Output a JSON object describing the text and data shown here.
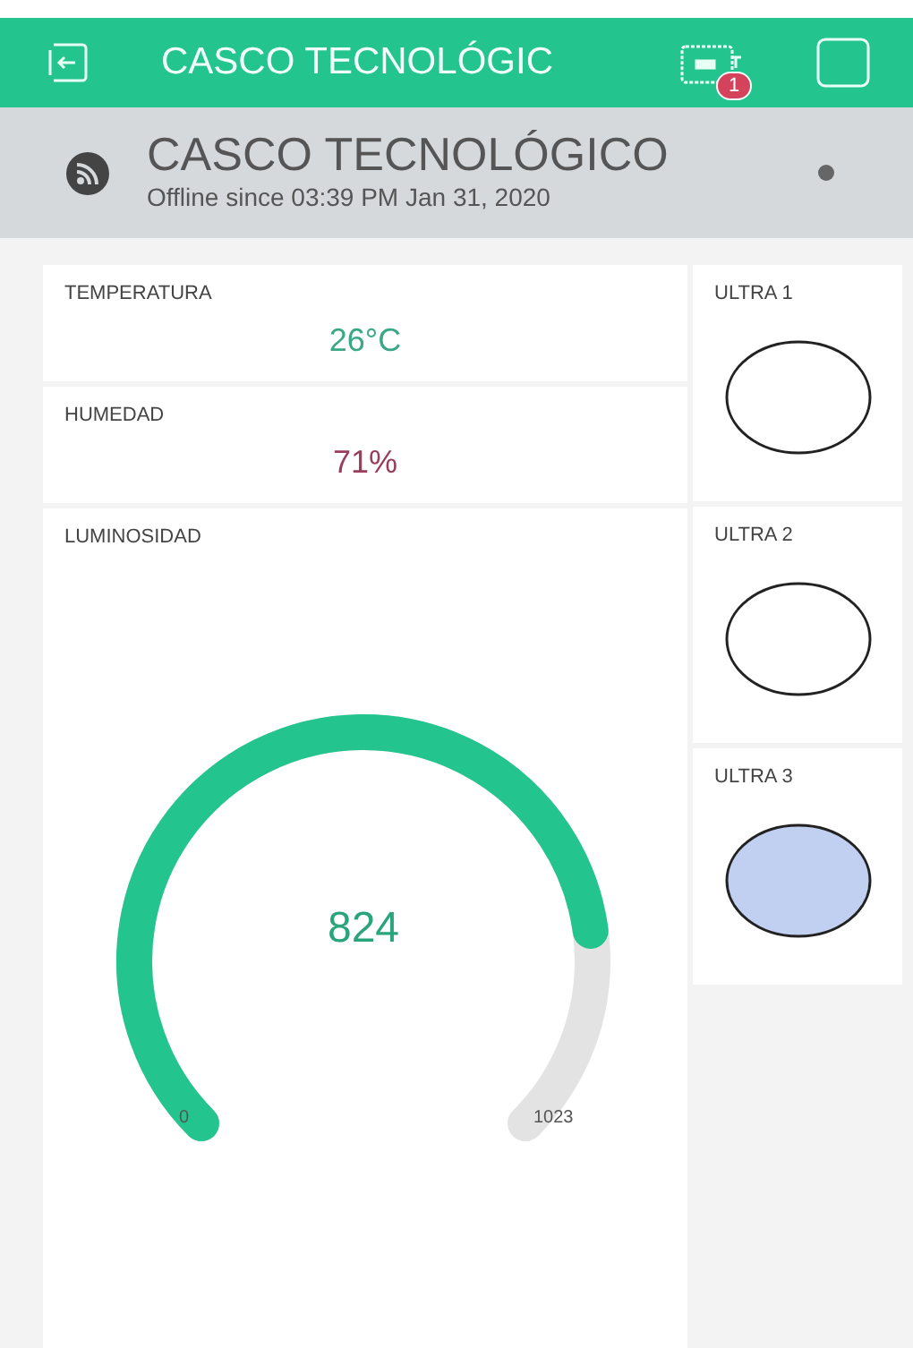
{
  "top_bar": {
    "title": "CASCO TECNOLÓGIC",
    "notification_count": "1"
  },
  "device": {
    "name": "CASCO TECNOLÓGICO",
    "status": "Offline since 03:39 PM Jan 31, 2020"
  },
  "displays": [
    {
      "label": "TEMPERATURA",
      "value": "26°C",
      "color": "#3aa886"
    },
    {
      "label": "HUMEDAD",
      "value": "71%",
      "color": "#9a3d5a"
    }
  ],
  "gauge": {
    "label": "LUMINOSIDAD",
    "value": "824",
    "min": "0",
    "max": "1023"
  },
  "leds": [
    {
      "label": "ULTRA 1",
      "on": false
    },
    {
      "label": "ULTRA 2",
      "on": false
    },
    {
      "label": "ULTRA 3",
      "on": true
    }
  ]
}
